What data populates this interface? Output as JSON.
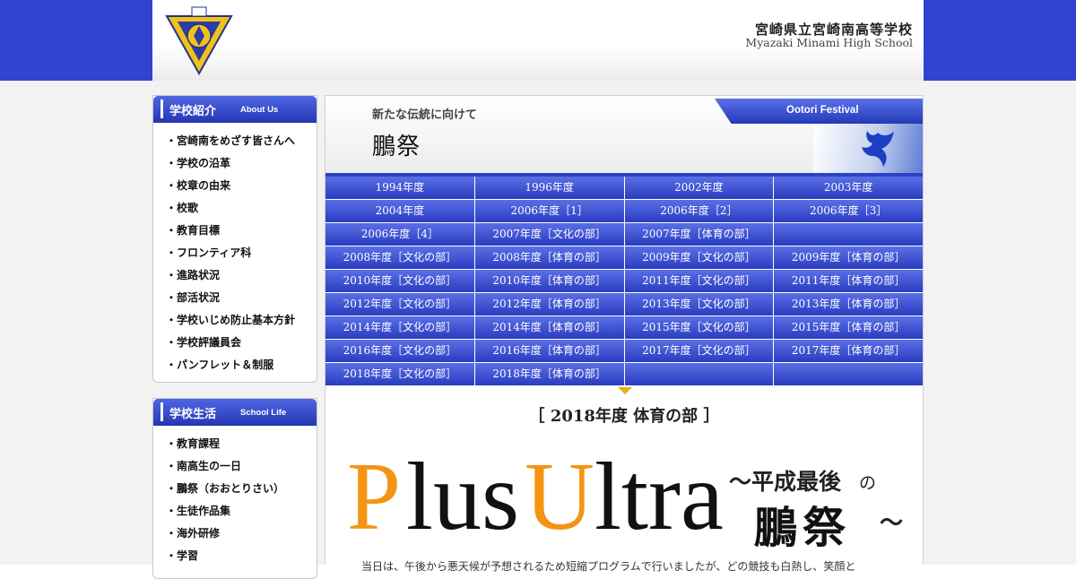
{
  "header": {
    "school_name_jp": "宮崎県立宮崎南高等学校",
    "school_name_en": "Myazaki Minami High School"
  },
  "sidebar": {
    "about": {
      "title_jp": "学校紹介",
      "title_en": "About Us",
      "items": [
        "宮崎南をめざす皆さんへ",
        "学校の沿革",
        "校章の由来",
        "校歌",
        "教育目標",
        "フロンティア科",
        "進路状況",
        "部活状況",
        "学校いじめ防止基本方針",
        "学校評議員会",
        "パンフレット＆制服"
      ]
    },
    "life": {
      "title_jp": "学校生活",
      "title_en": "School Life",
      "items": [
        "教育課程",
        "南高生の一日",
        "鵬祭（おおとりさい）",
        "生徒作品集",
        "海外研修",
        "学習"
      ]
    }
  },
  "main": {
    "subtitle": "新たな伝統に向けて",
    "title": "鵬祭",
    "tab_label": "Ootori Festival",
    "years": [
      "1994年度",
      "1996年度",
      "2002年度",
      "2003年度",
      "2004年度",
      "2006年度［1］",
      "2006年度［2］",
      "2006年度［3］",
      "2006年度［4］",
      "2007年度［文化の部］",
      "2007年度［体育の部］",
      "",
      "2008年度［文化の部］",
      "2008年度［体育の部］",
      "2009年度［文化の部］",
      "2009年度［体育の部］",
      "2010年度［文化の部］",
      "2010年度［体育の部］",
      "2011年度［文化の部］",
      "2011年度［体育の部］",
      "2012年度［文化の部］",
      "2012年度［体育の部］",
      "2013年度［文化の部］",
      "2013年度［体育の部］",
      "2014年度［文化の部］",
      "2014年度［体育の部］",
      "2015年度［文化の部］",
      "2015年度［体育の部］",
      "2016年度［文化の部］",
      "2016年度［体育の部］",
      "2017年度［文化の部］",
      "2017年度［体育の部］",
      "2018年度［文化の部］",
      "2018年度［体育の部］",
      "",
      ""
    ],
    "section_title": "［ 2018年度 体育の部 ］",
    "banner": {
      "p": "P",
      "lus": "lus",
      "u": "U",
      "ltra": "ltra",
      "heisei": "～平成最後",
      "no": "の",
      "ootori": "鵬祭",
      "tilde": "～"
    },
    "body_text": "当日は、午後から悪天候が予想されるため短縮プログラムで行いましたが、どの競技も白熱し、笑顔と"
  },
  "colors": {
    "primary_blue": "#2f45cf",
    "orange": "#f39512"
  }
}
